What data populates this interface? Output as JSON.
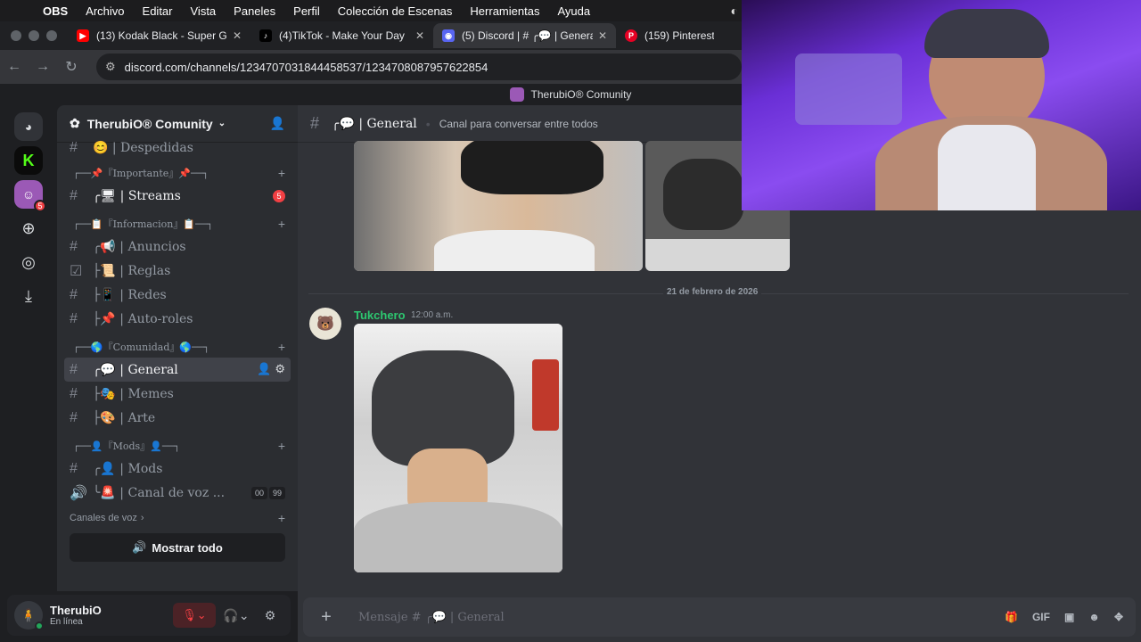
{
  "menubar": {
    "app": "OBS",
    "items": [
      "Archivo",
      "Editar",
      "Vista",
      "Paneles",
      "Perfil",
      "Colección de Escenas",
      "Herramientas",
      "Ayuda"
    ]
  },
  "tabs": [
    {
      "title": "(13) Kodak Black - Super Gre",
      "icon": "youtube-icon",
      "color": "#ff0000"
    },
    {
      "title": "(4)TikTok - Make Your Day",
      "icon": "tiktok-icon",
      "color": "#000000"
    },
    {
      "title": "(5) Discord | # ╭💬 | Genera",
      "icon": "discord-icon",
      "color": "#5865f2"
    },
    {
      "title": "(159) Pinterest",
      "icon": "pinterest-icon",
      "color": "#e60023"
    }
  ],
  "url": "discord.com/channels/1234707031844458537/1234708087957622854",
  "window_title": "TherubiO® Comunity",
  "guild_badge": "5",
  "server": {
    "name": "TherubiO® Comunity"
  },
  "channels": {
    "despedidas": "😊 | Despedidas",
    "cat_importante": "┌──📌『Importante』📌──┐",
    "streams": "╭🖥 | Streams",
    "streams_badge": "5",
    "cat_informacion": "┌──📋『Informacion』📋──┐",
    "anuncios": "╭📢 | Anuncios",
    "reglas": "├📜 | Reglas",
    "redes": "├📱 | Redes",
    "autoroles": "├📌 | Auto-roles",
    "cat_comunidad": "┌──🌎『Comunidad』🌎──┐",
    "general": "╭💬 | General",
    "memes": "├🎭 | Memes",
    "arte": "├🎨 | Arte",
    "cat_mods": "┌──👤『Mods』👤──┐",
    "mods": "╭👤 | Mods",
    "canal_voz": "╰🚨 | Canal de voz ...",
    "vc_a": "00",
    "vc_b": "99",
    "voice_cat": "Canales de voz",
    "show_all": "Mostrar todo"
  },
  "user": {
    "name": "TherubiO",
    "status": "En línea"
  },
  "chat": {
    "channel": "╭💬 | General",
    "topic": "Canal para conversar entre todos",
    "date_divider": "21 de febrero de 2026",
    "author": "Tukchero",
    "time": "12:00 a.m.",
    "placeholder": "Mensaje # ╭💬 | General",
    "composer_icons": [
      "gift-icon",
      "gif-icon",
      "sticker-icon",
      "emoji-icon",
      "apps-icon"
    ]
  }
}
